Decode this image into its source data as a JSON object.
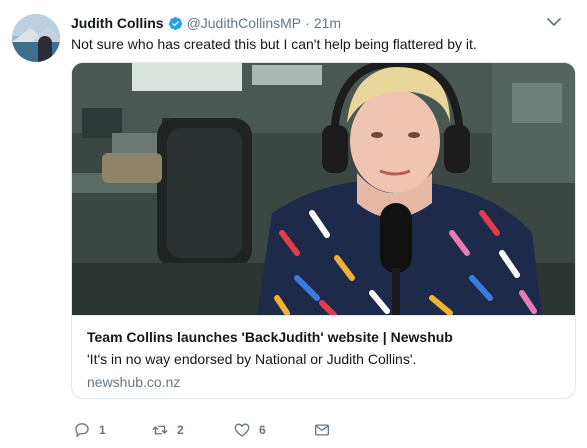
{
  "author": {
    "display_name": "Judith Collins",
    "handle": "@JudithCollinsMP",
    "separator": "·",
    "time": "21m",
    "verified": true
  },
  "tweet": {
    "text": "Not sure who has created this but I can't help being flattered by it."
  },
  "card": {
    "title": "Team Collins launches 'BackJudith' website | Newshub",
    "description": "'It's in no way endorsed by National or Judith Collins'.",
    "domain": "newshub.co.nz"
  },
  "actions": {
    "reply_count": "1",
    "retweet_count": "2",
    "like_count": "6"
  },
  "colors": {
    "accent": "#1da1f2",
    "muted": "#657786",
    "text": "#14171a",
    "border": "#e1e8ed"
  },
  "icons": [
    "verified-badge-icon",
    "chevron-down-icon",
    "reply-icon",
    "retweet-icon",
    "like-icon",
    "direct-message-icon"
  ]
}
